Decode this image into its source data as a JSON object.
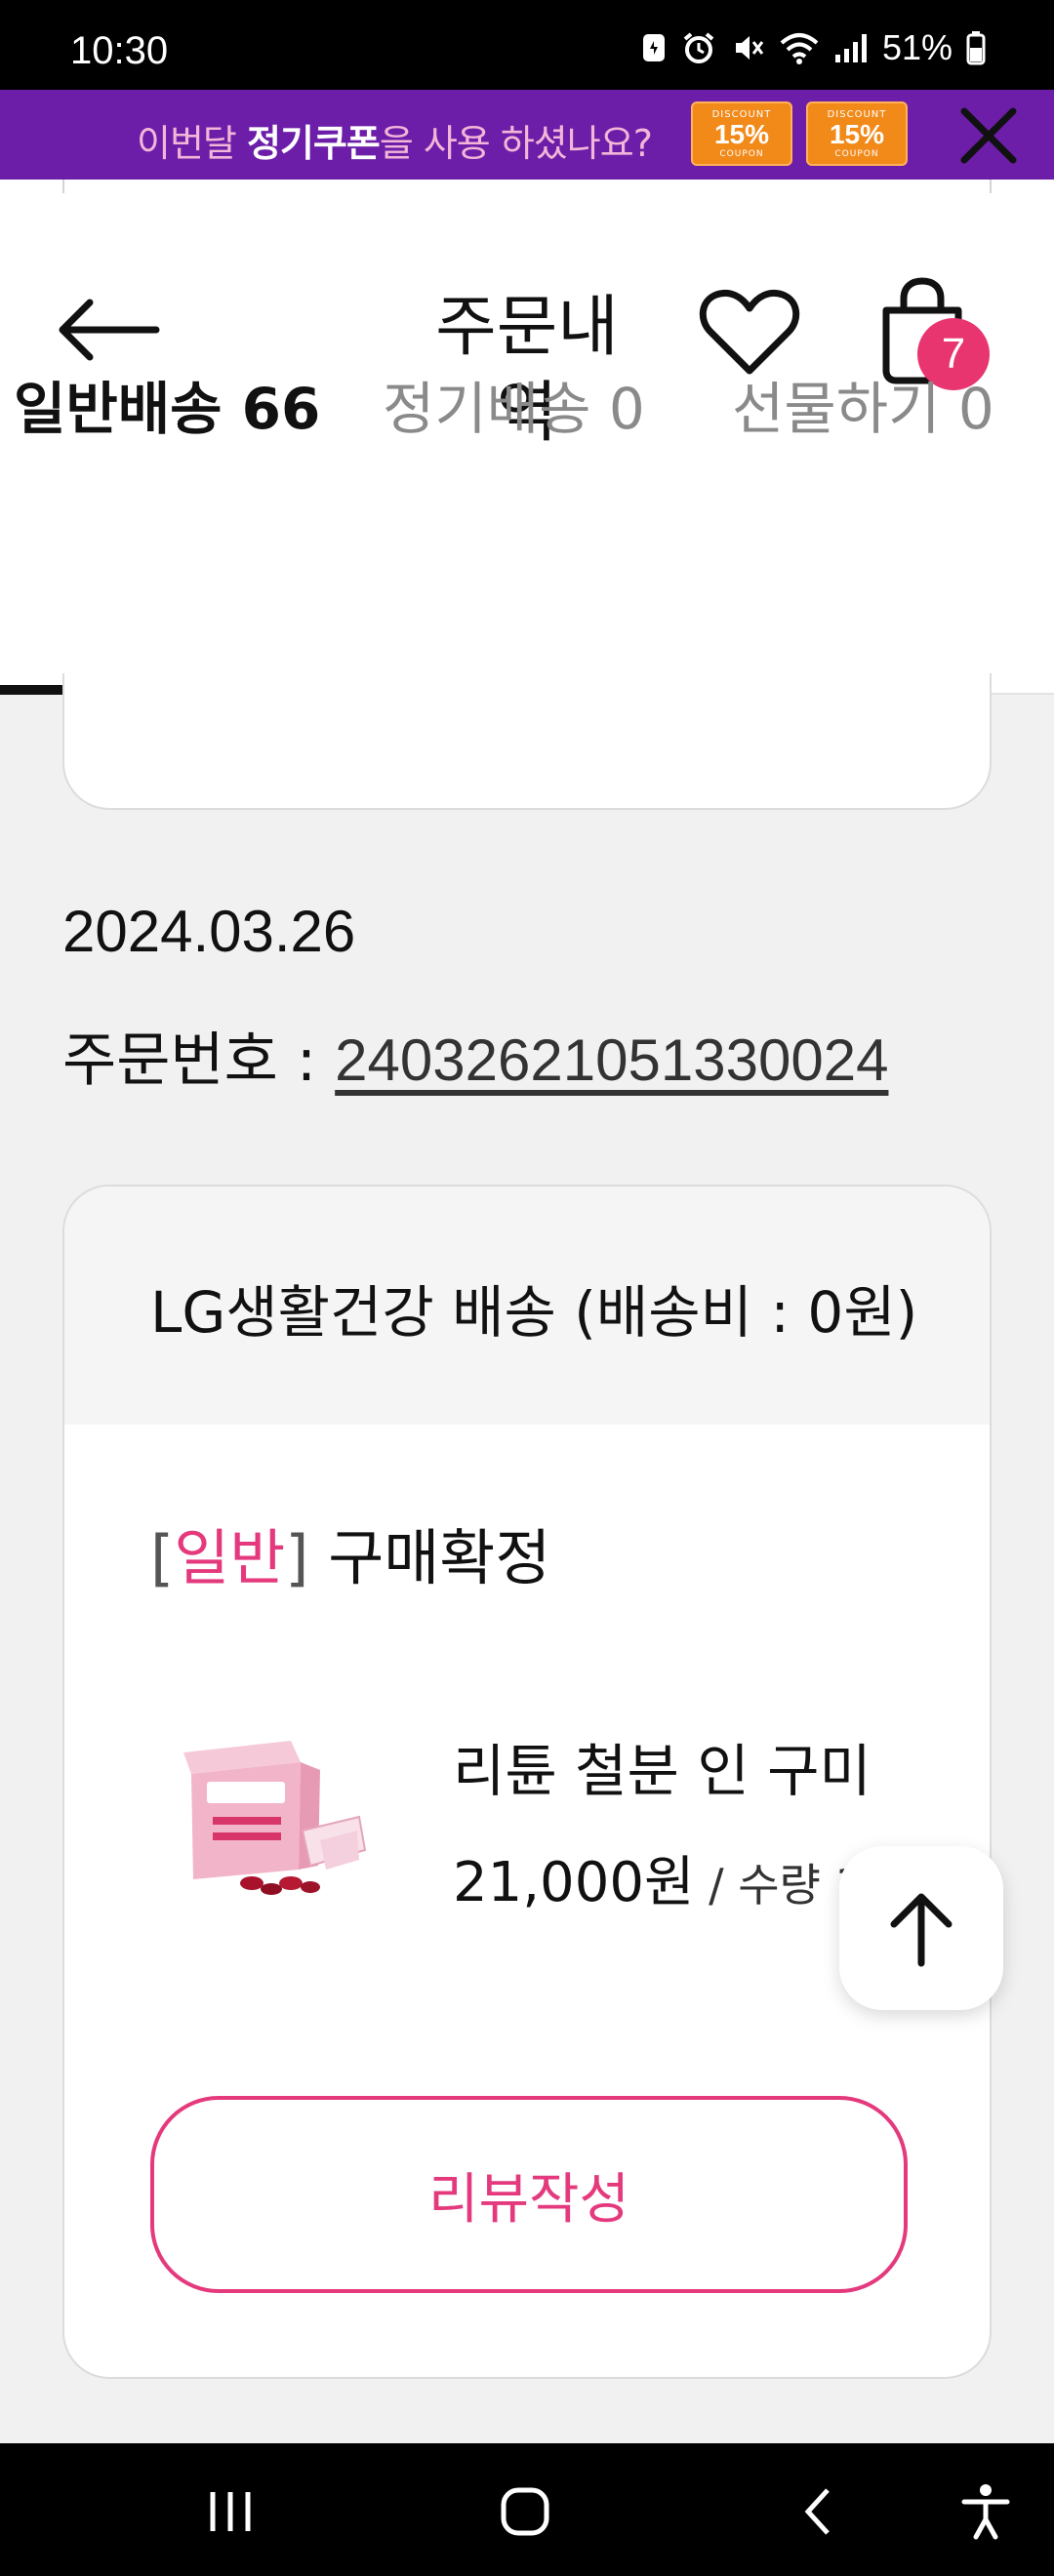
{
  "status_bar": {
    "time": "10:30",
    "battery": "51%"
  },
  "banner": {
    "prefix": "이번달 ",
    "highlight": "정기쿠폰",
    "suffix": "을 사용 하셨나요?",
    "coupons": [
      {
        "top": "DISCOUNT",
        "main": "15%",
        "bottom": "COUPON"
      },
      {
        "top": "DISCOUNT",
        "main": "15%",
        "bottom": "COUPON"
      }
    ]
  },
  "header": {
    "title": "주문내역",
    "cart_count": "7"
  },
  "tabs": [
    {
      "label": "일반배송 66"
    },
    {
      "label": "정기배송 0"
    },
    {
      "label": "선물하기 0"
    }
  ],
  "order": {
    "date": "2024.03.26",
    "number_label": "주문번호 : ",
    "number": "24032621051330024",
    "seller": "LG생활건강 배송 (배송비 : 0원)",
    "status": {
      "open": "[",
      "type": "일반",
      "close": "]",
      "text": " 구매확정"
    },
    "product": {
      "name": "리튠 철분 인 구미",
      "price": "21,000원",
      "separator": " / ",
      "quantity": "수량 1개"
    },
    "review_button": "리뷰작성"
  },
  "colors": {
    "brand_purple": "#6c1ea8",
    "accent_pink": "#e43a7d",
    "coupon_orange": "#f28a1a"
  }
}
